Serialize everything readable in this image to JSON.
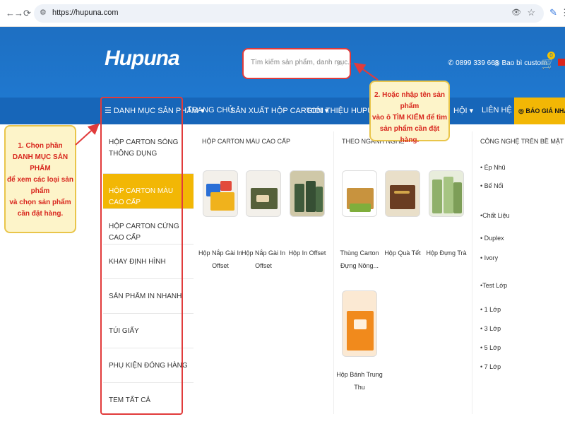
{
  "browser": {
    "url": "https://hupuna.com",
    "back_icon": "←",
    "forward_icon": "→",
    "reload_icon": "⟳"
  },
  "header": {
    "logo": "Hupuna",
    "search_placeholder": "Tìm kiếm sản phẩm, danh mục...",
    "phone": "0899 339 668",
    "account": "Bao bì custom",
    "cart_count": "0"
  },
  "nav": {
    "menu_label": "DANH MỤC SẢN PHẨM",
    "items": [
      "TRANG CHỦ",
      "SẢN XUẤT HỘP CARTON",
      "GIỚI THIỆU HUPUNA",
      "HỘI",
      "LIÊN HỆ"
    ],
    "quote_button": "BÁO GIÁ NHANH"
  },
  "sidebar": {
    "items": [
      "HỘP CARTON SÓNG THÔNG DỤNG",
      "HỘP CARTON MÀU CAO CẤP",
      "HỘP CARTON CỨNG CAO CẤP",
      "KHAY ĐỊNH HÌNH",
      "SẢN PHẨM IN NHANH",
      "TÚI GIẤY",
      "PHỤ KIỆN ĐÓNG HÀNG",
      "TEM TẤT CẢ"
    ],
    "active_index": 1
  },
  "columns": {
    "premium": {
      "title": "HỘP CARTON MÀU CAO CẤP",
      "products": [
        "Hộp Nắp Gài In Offset",
        "Hộp Nắp Gài In Offset",
        "Hộp In Offset"
      ]
    },
    "industry": {
      "title": "THEO NGÀNH NGHỀ",
      "products": [
        "Thùng Carton Đựng Nông...",
        "Hộp Quà Tết",
        "Hộp Đựng Trà",
        "Hộp Bánh Trung Thu"
      ]
    },
    "tech": {
      "title": "CÔNG NGHỆ TRÊN BỀ MẶT IN",
      "items": [
        "• Ép Nhũ",
        "• Bế Nổi",
        "•Chất Liệu",
        "• Duplex",
        "• Ivory",
        "•Test Lớp",
        "• 1 Lớp",
        "• 3 Lớp",
        "• 5 Lớp",
        "• 7 Lớp"
      ]
    }
  },
  "callouts": {
    "left": [
      "1. Chọn phần",
      "DANH MỤC SẢN PHẨM",
      "để xem các loại sản phẩm",
      "và chọn sản phẩm",
      "cần đặt hàng."
    ],
    "right": [
      "2. Hoặc nhập tên sản phẩm",
      "vào ô TÌM KIẾM để tìm",
      "sản phẩm cần đặt hàng."
    ]
  },
  "colors": {
    "header_blue": "#1e6fc2",
    "nav_blue": "#1766b9",
    "accent_yellow": "#f2b705",
    "annotation_red": "#e13b3b",
    "callout_bg": "#fdf4c9"
  }
}
